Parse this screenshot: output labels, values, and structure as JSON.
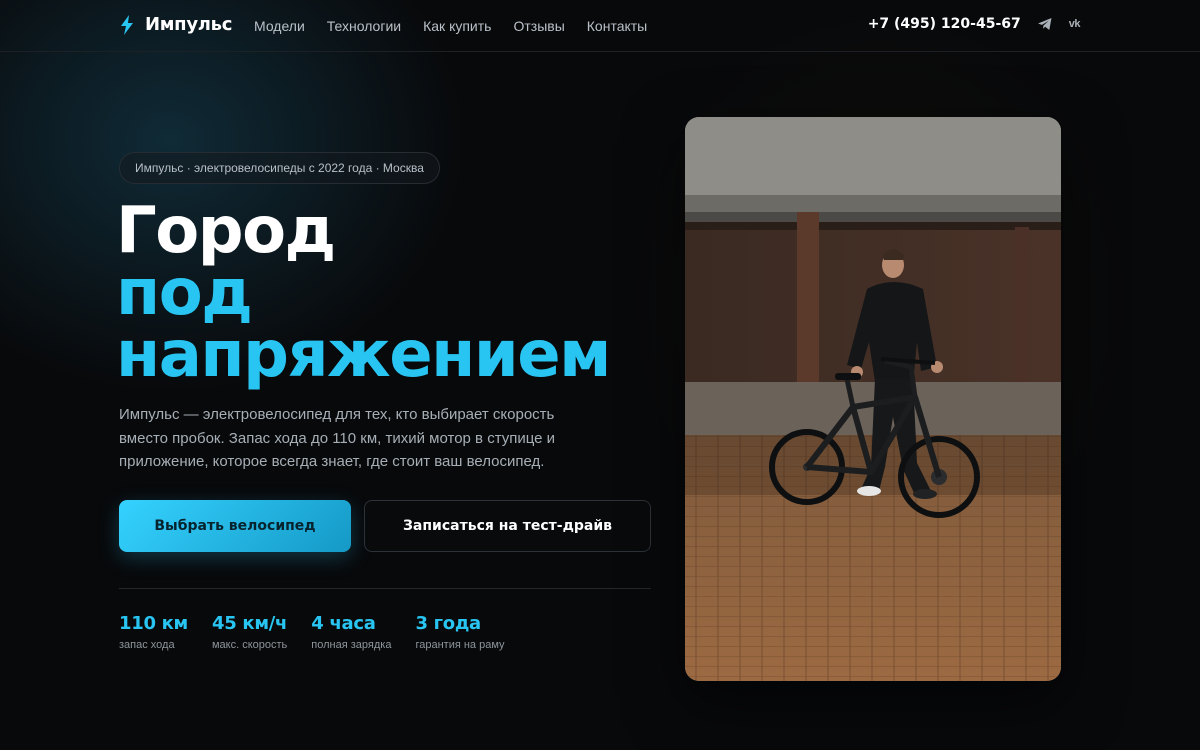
{
  "nav": {
    "brand": "Импульс",
    "brand_icon": "lightning-icon",
    "menu": [
      "Модели",
      "Технологии",
      "Как купить",
      "Отзывы",
      "Контакты"
    ],
    "phone": "+7 (495) 120-45-67",
    "social": [
      {
        "icon": "telegram-icon"
      },
      {
        "icon": "vk-icon",
        "label": "vk"
      }
    ]
  },
  "hero": {
    "badge": "Импульс · электровелосипеды с 2022 года · Москва",
    "headline": [
      "Город",
      "под",
      "напряжением"
    ],
    "lead": "Импульс — электровелосипед для тех, кто выбирает скорость вместо пробок. Запас хода до 110 км, тихий мотор в ступице и приложение, которое всегда знает, где стоит ваш велосипед.",
    "primary_button": "Выбрать велосипед",
    "secondary_button": "Записаться на тест-драйв",
    "stats": [
      {
        "value": "110 км",
        "label": "запас хода"
      },
      {
        "value": "45 км/ч",
        "label": "макс. скорость"
      },
      {
        "value": "4 часа",
        "label": "полная зарядка"
      },
      {
        "value": "3 года",
        "label": "гарантия на раму"
      }
    ]
  },
  "colors": {
    "background": "#08090b",
    "accent": "#29c5f2",
    "text": "#ffffff",
    "muted": "#a7afb6"
  }
}
